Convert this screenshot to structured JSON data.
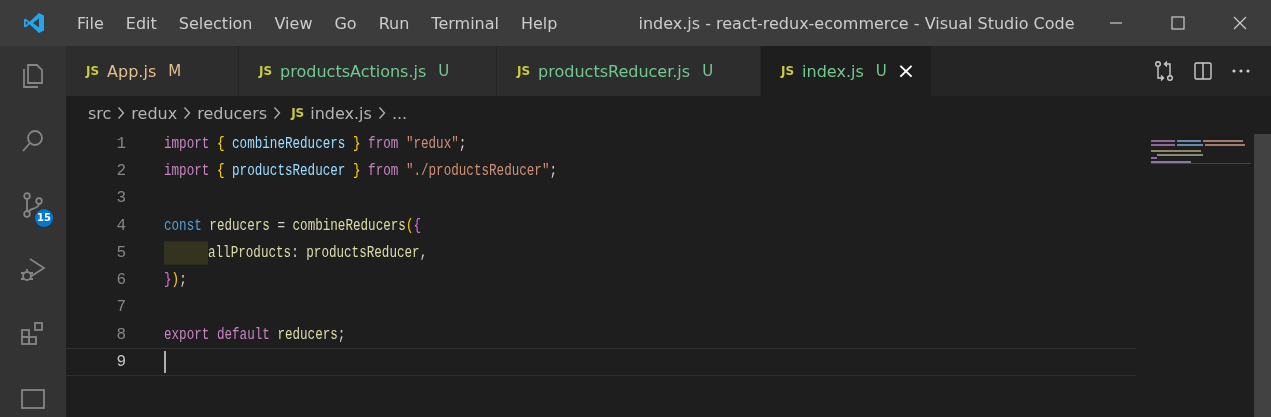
{
  "window": {
    "title": "index.js - react-redux-ecommerce - Visual Studio Code"
  },
  "menu": [
    "File",
    "Edit",
    "Selection",
    "View",
    "Go",
    "Run",
    "Terminal",
    "Help"
  ],
  "activity_bar": [
    {
      "kind": "files"
    },
    {
      "kind": "search"
    },
    {
      "kind": "scm",
      "badge": "15"
    },
    {
      "kind": "debug"
    },
    {
      "kind": "extensions"
    },
    {
      "kind": "panel"
    }
  ],
  "tabs": [
    {
      "icon": "JS",
      "label": "App.js",
      "status": "M",
      "selected": false
    },
    {
      "icon": "JS",
      "label": "productsActions.js",
      "status": "U",
      "selected": false
    },
    {
      "icon": "JS",
      "label": "productsReducer.js",
      "status": "U",
      "selected": false
    },
    {
      "icon": "JS",
      "label": "index.js",
      "status": "U",
      "selected": true,
      "close": "×"
    }
  ],
  "breadcrumb": [
    {
      "kind": "folder",
      "text": "src"
    },
    {
      "kind": "sep"
    },
    {
      "kind": "folder",
      "text": "redux"
    },
    {
      "kind": "sep"
    },
    {
      "kind": "folder",
      "text": "reducers"
    },
    {
      "kind": "sep"
    },
    {
      "kind": "icon",
      "text": "JS"
    },
    {
      "kind": "file",
      "text": "index.js"
    },
    {
      "kind": "sep"
    },
    {
      "kind": "folder",
      "text": "..."
    }
  ],
  "editor": {
    "lines": [
      {
        "number": "1",
        "current": false,
        "tokens": [
          {
            "kind": "keyword",
            "text": "import"
          },
          {
            "kind": "brace",
            "text": " {"
          },
          {
            "kind": "variable",
            "text": " combineReducers"
          },
          {
            "kind": "brace",
            "text": " }"
          },
          {
            "kind": "keyword",
            "text": " from"
          },
          {
            "kind": "string",
            "text": " \"redux\""
          },
          {
            "kind": "plain",
            "text": ";"
          }
        ]
      },
      {
        "number": "2",
        "current": false,
        "tokens": [
          {
            "kind": "keyword",
            "text": "import"
          },
          {
            "kind": "brace",
            "text": " {"
          },
          {
            "kind": "variable",
            "text": " productsReducer"
          },
          {
            "kind": "brace",
            "text": " }"
          },
          {
            "kind": "keyword",
            "text": " from"
          },
          {
            "kind": "string",
            "text": " \"./productsReducer\""
          },
          {
            "kind": "plain",
            "text": ";"
          }
        ]
      },
      {
        "number": "3",
        "current": false
      },
      {
        "number": "4",
        "current": false,
        "tokens": [
          {
            "kind": "storage",
            "text": "const"
          },
          {
            "kind": "name",
            "text": " reducers"
          },
          {
            "kind": "plain",
            "text": " ="
          },
          {
            "kind": "function",
            "text": " combineReducers"
          },
          {
            "kind": "brace",
            "text": "("
          },
          {
            "kind": "brace2",
            "text": "{"
          }
        ]
      },
      {
        "number": "5",
        "current": false,
        "tokens": [
          {
            "kind": "indent"
          },
          {
            "kind": "name",
            "text": "allProducts"
          },
          {
            "kind": "plain",
            "text": ":"
          },
          {
            "kind": "name",
            "text": " productsReducer"
          },
          {
            "kind": "plain",
            "text": ","
          }
        ]
      },
      {
        "number": "6",
        "current": false,
        "tokens": [
          {
            "kind": "brace2",
            "text": "}"
          },
          {
            "kind": "brace",
            "text": ")"
          },
          {
            "kind": "plain",
            "text": ";"
          }
        ]
      },
      {
        "number": "7",
        "current": false
      },
      {
        "number": "8",
        "current": false,
        "tokens": [
          {
            "kind": "keyword",
            "text": "export"
          },
          {
            "kind": "keyword",
            "text": " default"
          },
          {
            "kind": "name",
            "text": " reducers"
          },
          {
            "kind": "plain",
            "text": ";"
          }
        ]
      },
      {
        "number": "9",
        "current": true
      }
    ]
  }
}
